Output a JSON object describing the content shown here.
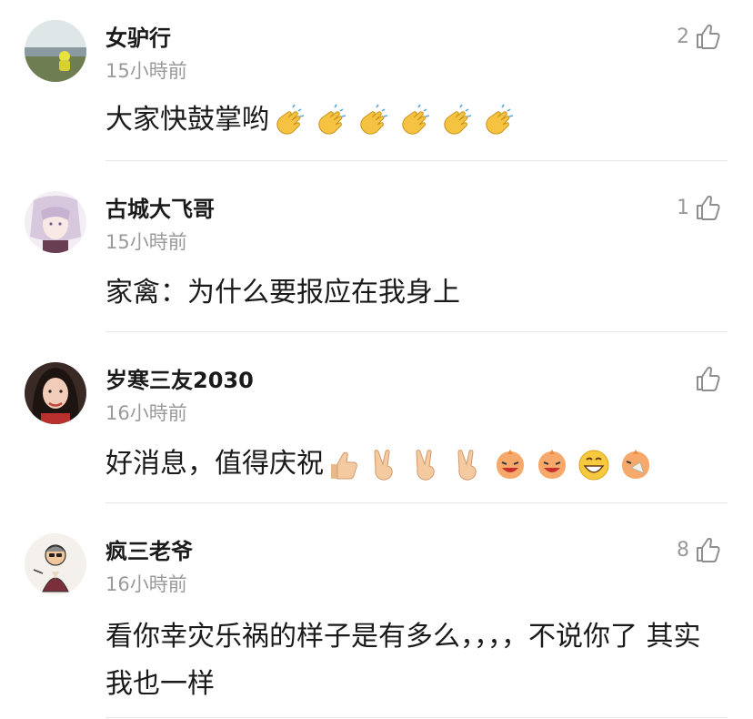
{
  "comments": [
    {
      "username": "女驴行",
      "time": "15小時前",
      "likes": "2",
      "text": "大家快鼓掌哟",
      "emojis": [
        "clap-emoji",
        "clap-emoji",
        "clap-emoji",
        "clap-emoji",
        "clap-emoji",
        "clap-emoji"
      ]
    },
    {
      "username": "古城大飞哥",
      "time": "15小時前",
      "likes": "1",
      "text": "家禽：为什么要报应在我身上",
      "emojis": []
    },
    {
      "username": "岁寒三友2030",
      "time": "16小時前",
      "likes": "",
      "text": "好消息，值得庆祝",
      "emojis": [
        "thumbs-up-emoji",
        "victory-emoji",
        "victory-emoji",
        "victory-emoji",
        "laughing-face-emoji",
        "laughing-face-emoji",
        "grinning-face-emoji",
        "laughing-fan-emoji"
      ]
    },
    {
      "username": "疯三老爷",
      "time": "16小時前",
      "likes": "8",
      "text": "看你幸灾乐祸的样子是有多么，，，，不说你了 其实我也一样",
      "emojis": []
    }
  ],
  "icons": {
    "like": "thumbs-up-outline-icon"
  },
  "colors": {
    "text": "#1a1a1a",
    "meta": "#9a9a9a",
    "divider": "#e6e6e6"
  }
}
